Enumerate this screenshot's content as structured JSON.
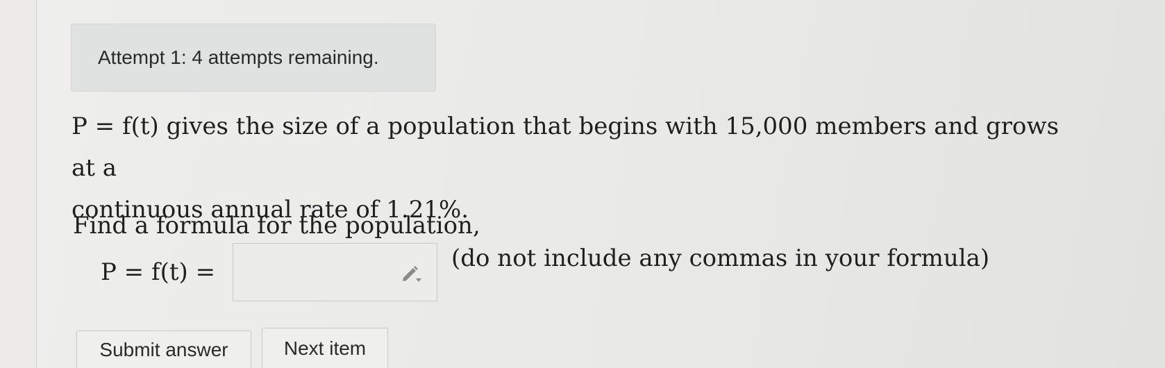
{
  "attempt_banner": {
    "text": "Attempt 1: 4 attempts remaining."
  },
  "problem": {
    "lhs": "P = f(t)",
    "line1_rest": " gives the size of a population that begins with 15,000 members and grows at a",
    "line2": "continuous annual rate of 1.21%."
  },
  "instruction": "Find a formula for the population,",
  "answer": {
    "label": "P = f(t) =",
    "value": "",
    "placeholder": "",
    "hint": "(do not include any commas in your formula)",
    "icon": "pencil-icon"
  },
  "buttons": {
    "submit_label": "Submit answer",
    "next_label": "Next item"
  },
  "colors": {
    "background": "#e9e9e6",
    "banner_bg": "#dfe2e1",
    "text": "#1f1f1f"
  }
}
